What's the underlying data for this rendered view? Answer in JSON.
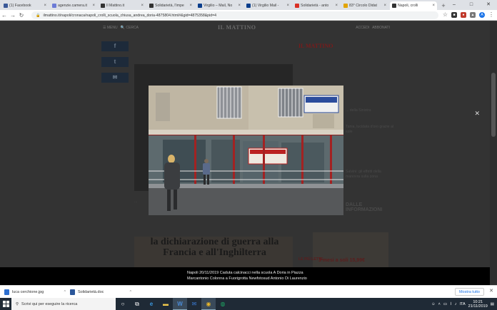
{
  "browser": {
    "tabs": [
      {
        "label": "(1) Facebook",
        "color": "#3b5998",
        "icon": "facebook-icon"
      },
      {
        "label": "agenzie.camera.it",
        "color": "#6c7bd6",
        "icon": "camera-icon"
      },
      {
        "label": "Il Mattino.it",
        "color": "#333333",
        "icon": "mattino-icon"
      },
      {
        "label": "Solidarietà, l'impe",
        "color": "#333333",
        "icon": "mattino-icon"
      },
      {
        "label": "Virgilio – Mail, No",
        "color": "#0a3e8c",
        "icon": "virgilio-icon"
      },
      {
        "label": "(1) Virgilio Mail -",
        "color": "#0a3e8c",
        "icon": "virgilio-icon"
      },
      {
        "label": "Solidarietà - anto",
        "color": "#d93025",
        "icon": "gmail-icon"
      },
      {
        "label": "83° Circolo Didat",
        "color": "#e2a400",
        "icon": "folder-icon"
      },
      {
        "label": "Napoli, crolli",
        "color": "#333333",
        "icon": "mattino-icon",
        "active": true
      }
    ],
    "url": "ilmattino.it/napoli/cronaca/napoli_crolli_scuola_chiusa_andrea_doria-4875804.html#&gid=4875358&pid=4"
  },
  "page": {
    "brand": "IL MATTINO",
    "menu_label": "MENU",
    "search_label": "CERCA",
    "login_label": "ACCEDI",
    "subscribe_label": "ABBONATI",
    "side_items": [
      "... della Sinistra",
      "Tania, lucidata d'oro grazie al sole",
      "Salvini: gli effetti della manovra sulla zona",
      "DALLE INFORMAZIONI"
    ],
    "bg_headline": "la dichiarazione di guerra alla Francia e all'Inghilterra",
    "ad_price": "3 mesi a soli 15,99€",
    "sponsored": "LE PIÙ LETTE",
    "photo_caption": "Napoli 20/11/2019 Caduta calcinacci nella scuola A Doria in Piazza Marcantonio Colonna a Fuorigrotta Newfotosud Antonio Di Laurenzio",
    "sign_text": "IL SEI REGIONALE PIÙ GIOVANE"
  },
  "downloads": {
    "items": [
      {
        "name": "luca cerchione.jpg"
      },
      {
        "name": "Solidarietà.doc"
      }
    ],
    "show_all": "Mostra tutto"
  },
  "taskbar": {
    "search_placeholder": "Scrivi qui per eseguire la ricerca",
    "time": "10:21",
    "date": "21/11/2019",
    "lang": "ITA"
  }
}
